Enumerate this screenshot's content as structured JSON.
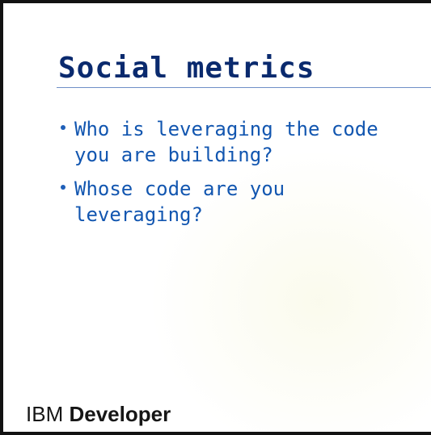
{
  "slide": {
    "title": "Social metrics",
    "bullets": [
      "Who is leveraging the code\nyou are building?",
      "Whose code are you\nleveraging?"
    ]
  },
  "footer": {
    "brand_prefix": "IBM",
    "brand_suffix": "Developer"
  },
  "colors": {
    "title": "#0a2a6e",
    "bullet_text": "#1256b0",
    "rule": "#6f8fc7"
  }
}
